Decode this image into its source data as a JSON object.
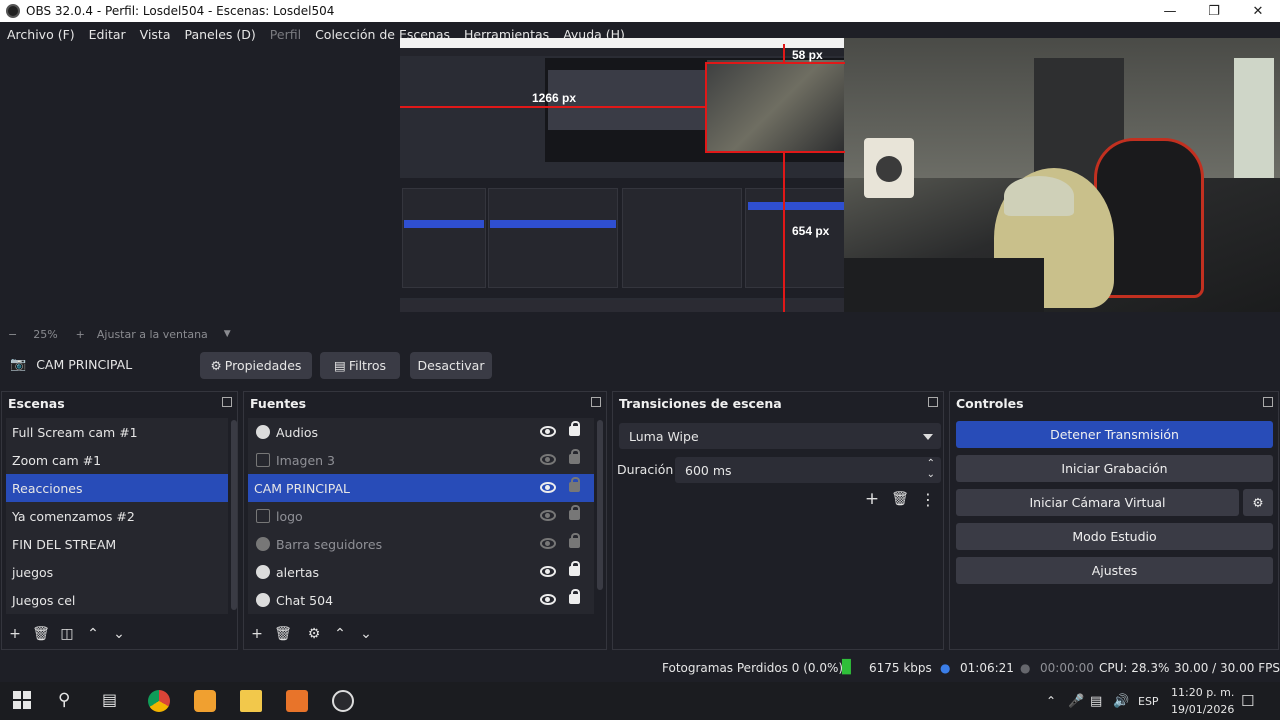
{
  "window": {
    "title": "OBS 32.0.4 - Perfil: Losdel504 - Escenas: Losdel504",
    "controls": [
      "minimize",
      "restore",
      "close"
    ]
  },
  "menu": {
    "items": [
      "Archivo (F)",
      "Editar",
      "Vista",
      "Paneles (D)",
      "Perfil",
      "Colección de Escenas",
      "Herramientas",
      "Ayuda (H)"
    ],
    "disabled": [
      "Perfil"
    ]
  },
  "preview": {
    "labels": {
      "width_measure": "1266 px",
      "top_measure": "58 px",
      "height_measure": "654 px"
    }
  },
  "zoom": {
    "minus": "−",
    "value": "25%",
    "plus": "+",
    "fit_label": "Ajustar a la ventana"
  },
  "source_bar": {
    "source_name": "CAM PRINCIPAL",
    "properties": "Propiedades",
    "filters": "Filtros",
    "deactivate": "Desactivar"
  },
  "scenes": {
    "title": "Escenas",
    "items": [
      "Full Scream cam #1",
      "Zoom cam #1",
      "Reacciones",
      "Ya comenzamos #2",
      "FIN DEL STREAM",
      "juegos",
      "Juegos cel"
    ],
    "selected": "Reacciones"
  },
  "sources": {
    "title": "Fuentes",
    "items": [
      {
        "name": "Audios",
        "icon": "globe-icon",
        "visible": true,
        "locked": true
      },
      {
        "name": "Imagen 3",
        "icon": "image-icon",
        "visible": false,
        "locked": false
      },
      {
        "name": "CAM PRINCIPAL",
        "icon": "camera-icon",
        "visible": true,
        "locked": false
      },
      {
        "name": "logo",
        "icon": "image-icon",
        "visible": false,
        "locked": false
      },
      {
        "name": "Barra seguidores",
        "icon": "globe-icon",
        "visible": false,
        "locked": false
      },
      {
        "name": "alertas",
        "icon": "globe-icon",
        "visible": true,
        "locked": true
      },
      {
        "name": "Chat 504",
        "icon": "globe-icon",
        "visible": true,
        "locked": true
      }
    ],
    "selected": "CAM PRINCIPAL"
  },
  "transitions": {
    "title": "Transiciones de escena",
    "selected": "Luma Wipe",
    "duration_label": "Duración",
    "duration_value": "600 ms"
  },
  "controls": {
    "title": "Controles",
    "stop_stream": "Detener Transmisión",
    "start_recording": "Iniciar Grabación",
    "start_virtual_cam": "Iniciar Cámara Virtual",
    "studio_mode": "Modo Estudio",
    "settings": "Ajustes"
  },
  "status": {
    "dropped_frames": "Fotogramas Perdidos 0 (0.0%)",
    "bitrate": "6175 kbps",
    "stream_time": "01:06:21",
    "record_time": "00:00:00",
    "cpu": "CPU: 28.3%",
    "fps": "30.00 / 30.00 FPS"
  },
  "taskbar": {
    "language": "ESP",
    "time": "11:20 p. m.",
    "date": "19/01/2026"
  },
  "colors": {
    "accent": "#284cb8",
    "background": "#1e1f26",
    "button": "#3a3b45",
    "measure_line": "#e01818",
    "bitrate_green": "#2fbf3a",
    "stream_dot": "#3b7ee8"
  }
}
